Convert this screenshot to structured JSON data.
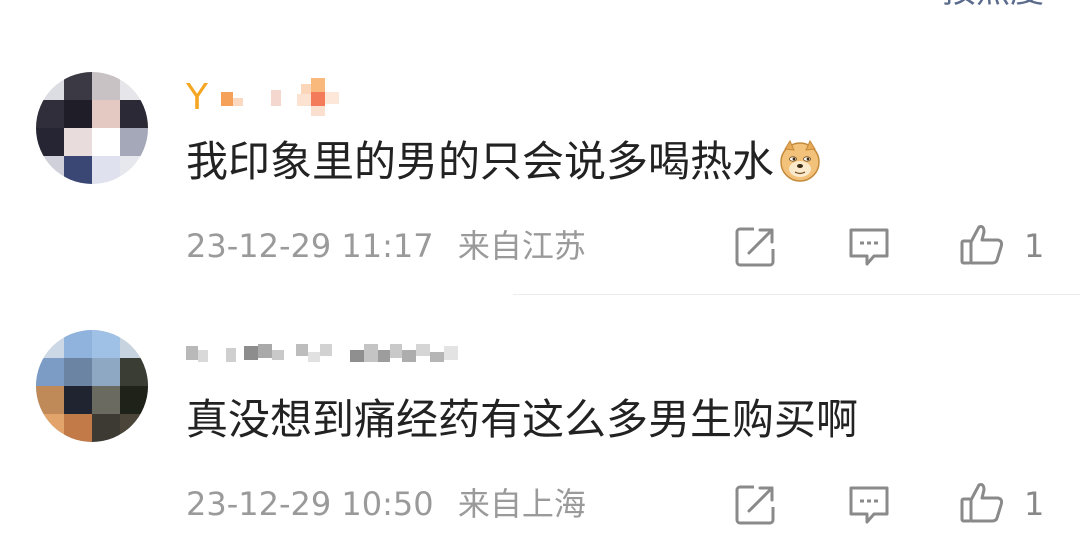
{
  "header": {
    "sort_label": "按热度"
  },
  "comments": [
    {
      "username_visible": "Y",
      "text": "我印象里的男的只会说多喝热水",
      "emoji": "doge-icon",
      "time": "23-12-29 11:17",
      "location": "来自江苏",
      "likes": "1"
    },
    {
      "username_visible": "",
      "text": "真没想到痛经药有这么多男生购买啊",
      "time": "23-12-29 10:50",
      "location": "来自上海",
      "likes": "1"
    }
  ],
  "colors": {
    "username_accent": "#f5a623",
    "text": "#222222",
    "meta": "#9a9a9a",
    "icon": "#8a8a8a"
  }
}
